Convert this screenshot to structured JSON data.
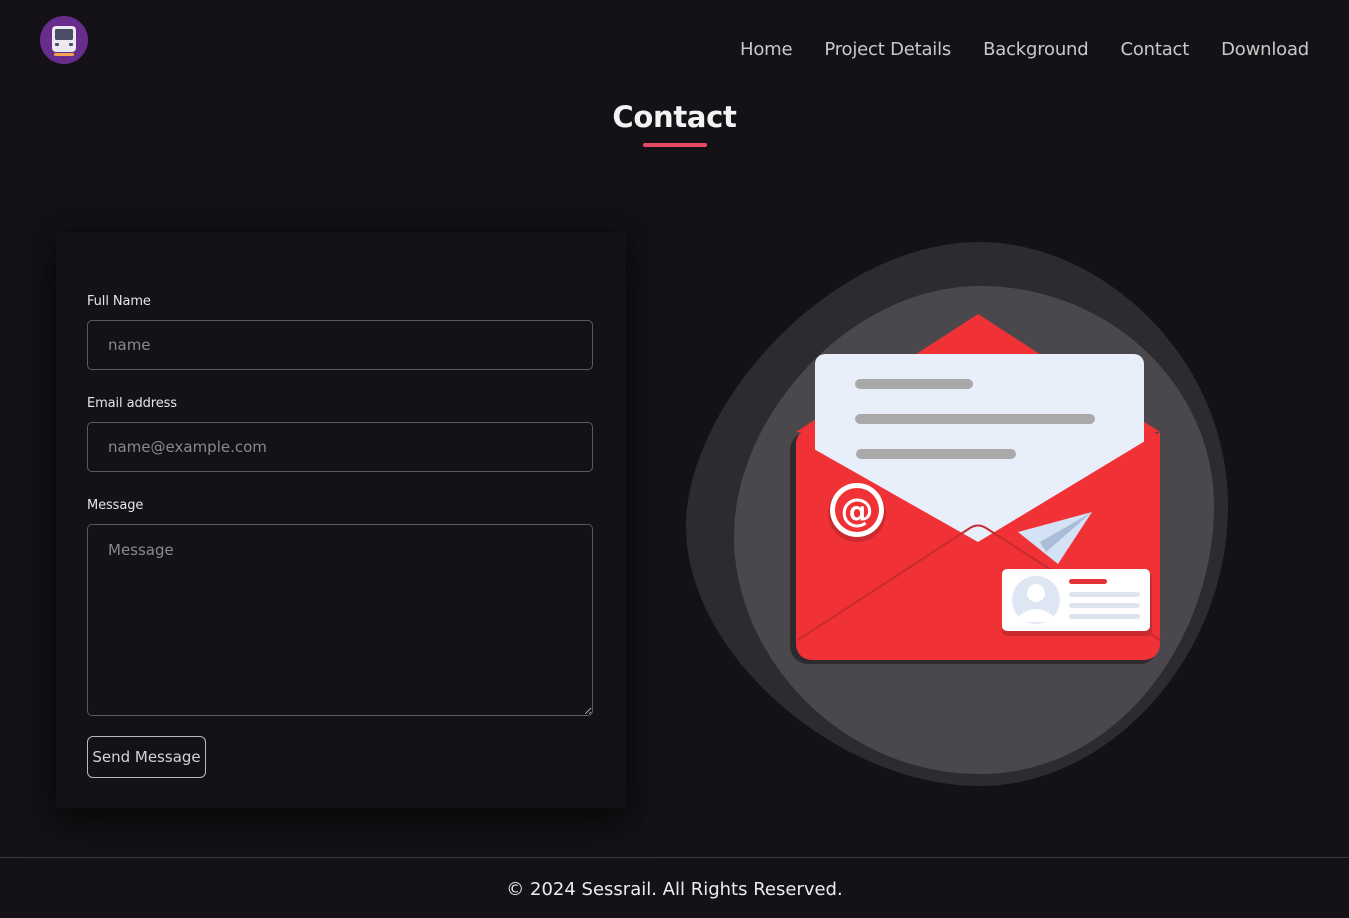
{
  "header": {
    "logo_icon": "train-icon",
    "nav": [
      {
        "label": "Home"
      },
      {
        "label": "Project Details"
      },
      {
        "label": "Background"
      },
      {
        "label": "Contact"
      },
      {
        "label": "Download"
      }
    ]
  },
  "page": {
    "title": "Contact",
    "accent_color": "#e84a65"
  },
  "form": {
    "name_label": "Full Name",
    "name_placeholder": "name",
    "email_label": "Email address",
    "email_placeholder": "name@example.com",
    "message_label": "Message",
    "message_placeholder": "Message",
    "submit_label": "Send Message"
  },
  "illustration": {
    "icon": "open-envelope-icon",
    "envelope_color": "#f03236",
    "at_symbol": "@"
  },
  "footer": {
    "copyright": "© 2024 Sessrail. All Rights Reserved."
  }
}
